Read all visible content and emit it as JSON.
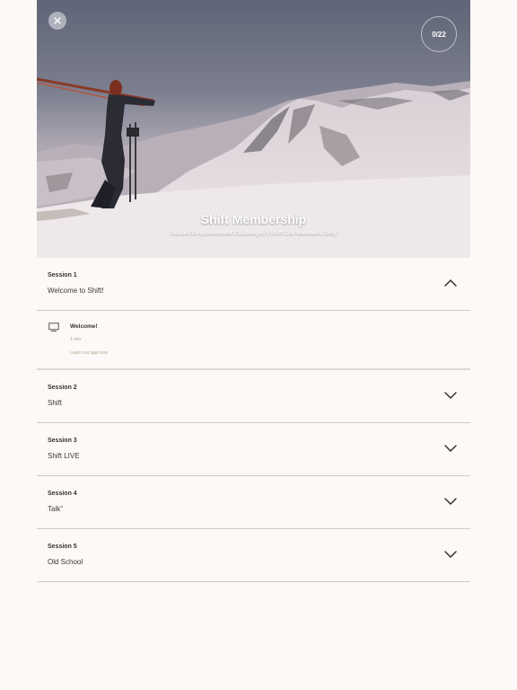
{
  "hero": {
    "title": "Shift Membership",
    "subtitle": "Guided Empowerment Challenges | Shift Life Members Only",
    "progress": "0/22",
    "close_icon": "close-icon"
  },
  "sections": [
    {
      "label": "Session 1",
      "title": "Welcome to Shift!",
      "expanded": true
    },
    {
      "label": "Session 2",
      "title": "Shift",
      "expanded": false
    },
    {
      "label": "Session 3",
      "title": "Shift LIVE",
      "expanded": false
    },
    {
      "label": "Session 4",
      "title": "Talk\"",
      "expanded": false
    },
    {
      "label": "Session 5",
      "title": "Old School",
      "expanded": false
    }
  ],
  "lesson": {
    "title": "Welcome!",
    "duration": "1 min",
    "link": "Learn our app now",
    "icon": "video-icon"
  },
  "colors": {
    "background": "#fdf9f7",
    "divider": "#cfcac8",
    "accent_green": "#9cae8c"
  }
}
